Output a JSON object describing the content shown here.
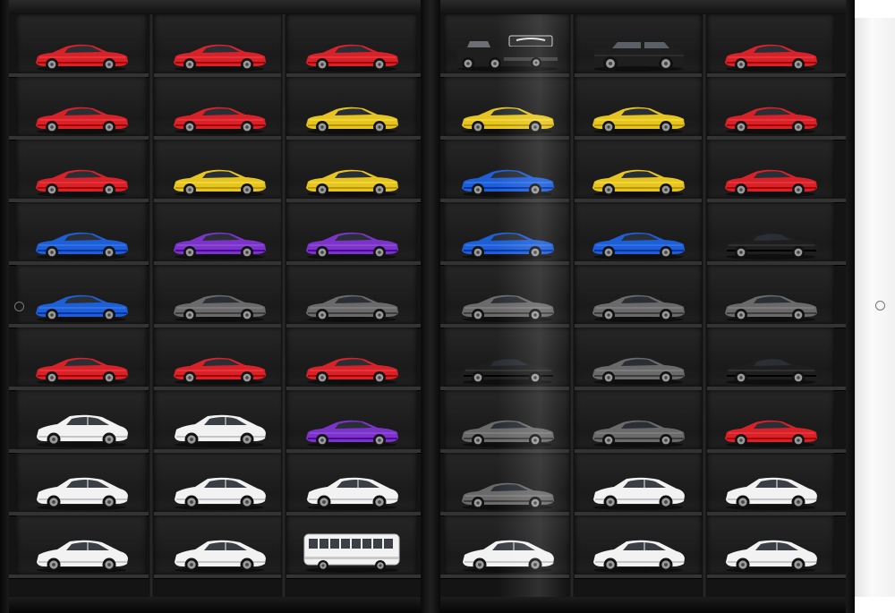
{
  "colors": {
    "red": "#d8222a",
    "yellow": "#e6c522",
    "blue": "#1f5fd6",
    "purple": "#7a35c8",
    "gray": "#6a6a6a",
    "black": "#1e1e1e",
    "white": "#f2f2f2"
  },
  "left_grid": [
    [
      "red-coupe",
      "red-coupe",
      "red-coupe"
    ],
    [
      "red-coupe",
      "red-coupe",
      "yellow-coupe"
    ],
    [
      "red-coupe",
      "yellow-coupe",
      "yellow-coupe"
    ],
    [
      "blue-coupe",
      "purple-coupe",
      "purple-coupe"
    ],
    [
      "blue-coupe",
      "gray-coupe",
      "gray-coupe"
    ],
    [
      "red-coupe",
      "red-coupe",
      "red-coupe"
    ],
    [
      "white-hatch",
      "white-hatch",
      "purple-coupe"
    ],
    [
      "white-hatch",
      "white-hatch",
      "white-hatch"
    ],
    [
      "white-hatch",
      "white-hatch",
      "white-bus"
    ]
  ],
  "right_grid": [
    [
      "black-truck-trailer",
      "black-suv",
      "red-coupe"
    ],
    [
      "yellow-coupe",
      "yellow-coupe",
      "red-coupe"
    ],
    [
      "blue-coupe",
      "yellow-coupe",
      "red-coupe"
    ],
    [
      "blue-coupe",
      "blue-coupe",
      "black-coupe"
    ],
    [
      "gray-coupe",
      "gray-coupe",
      "gray-coupe"
    ],
    [
      "black-coupe",
      "gray-coupe",
      "black-coupe"
    ],
    [
      "gray-coupe",
      "gray-coupe",
      "red-coupe"
    ],
    [
      "gray-coupe",
      "white-hatch",
      "white-hatch"
    ],
    [
      "white-hatch",
      "white-hatch",
      "white-hatch"
    ]
  ]
}
